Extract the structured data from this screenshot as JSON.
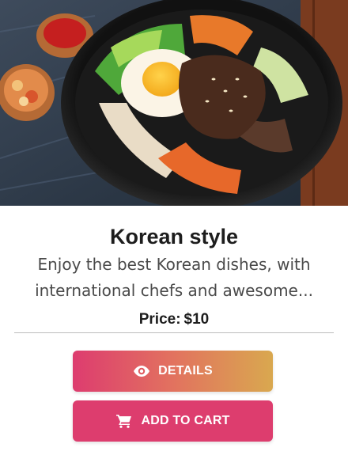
{
  "card": {
    "image_alt": "Bibimbap bowl",
    "title": "Korean style",
    "description": "Enjoy the best Korean dishes, with international chefs and awesome...",
    "price_label": "Price:",
    "price_value": "$10"
  },
  "actions": {
    "details_label": "DETAILS",
    "details_icon": "eye-icon",
    "cart_label": "ADD TO CART",
    "cart_icon": "cart-icon"
  },
  "colors": {
    "accent_pink": "#dd3d6e",
    "gradient_end": "#d9a84f"
  }
}
